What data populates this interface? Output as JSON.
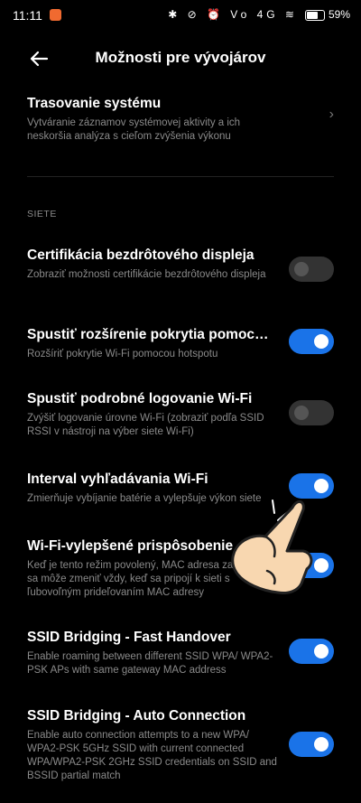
{
  "status": {
    "time": "11:11",
    "battery": "59%",
    "icons": "✱ ⊘ ⏰ Vo 4G ≋ "
  },
  "header": {
    "title": "Možnosti pre vývojárov"
  },
  "top_item": {
    "title": "Trasovanie systému",
    "subtitle": "Vytváranie záznamov systémovej aktivity a ich neskoršia analýza s cieľom zvýšenia výkonu"
  },
  "section": "SIETE",
  "items": [
    {
      "title": "Certifikácia bezdrôtového displeja",
      "subtitle": "Zobraziť možnosti certifikácie bezdrôtového displeja",
      "on": false
    },
    {
      "title": "Spustiť rozšírenie pokrytia pomocou...",
      "subtitle": "Rozšíriť pokrytie Wi-Fi pomocou hotspotu",
      "on": true
    },
    {
      "title": "Spustiť podrobné logovanie Wi-Fi",
      "subtitle": "Zvýšiť logovanie úrovne Wi-Fi (zobraziť podľa SSID RSSI v nástroji na výber siete Wi-Fi)",
      "on": false
    },
    {
      "title": "Interval vyhľadávania Wi-Fi",
      "subtitle": "Zmierňuje vybíjanie batérie a vylepšuje výkon siete",
      "on": true
    },
    {
      "title": "Wi-Fi-vylepšené prispôsobenie",
      "subtitle": "Keď je tento režim povolený, MAC adresa zariadenia sa môže zmeniť vždy, keď sa pripojí k sieti s ľubovoľným prideľovaním MAC adresy",
      "on": true
    },
    {
      "title": "SSID Bridging - Fast Handover",
      "subtitle": "Enable roaming between different SSID WPA/ WPA2-PSK APs with same gateway MAC address",
      "on": true
    },
    {
      "title": "SSID Bridging - Auto Connection",
      "subtitle": "Enable auto connection attempts to a new WPA/ WPA2-PSK 5GHz SSID with current connected WPA/WPA2-PSK 2GHz SSID credentials on SSID and BSSID partial match",
      "on": true
    }
  ]
}
